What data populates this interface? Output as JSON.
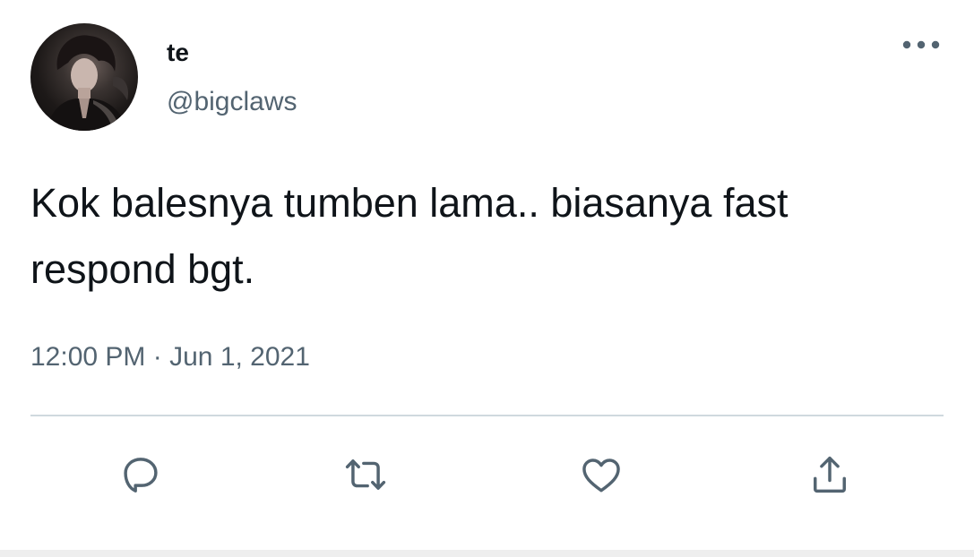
{
  "author": {
    "display_name": "te",
    "handle": "@bigclaws"
  },
  "tweet": {
    "text": "Kok balesnya tumben lama.. biasanya fast respond bgt.",
    "time": "12:00 PM",
    "separator": "·",
    "date": "Jun 1, 2021"
  },
  "icons": {
    "more": "more-dots-icon",
    "reply": "reply-bubble-icon",
    "retweet": "retweet-icon",
    "like": "heart-icon",
    "share": "share-upload-icon"
  },
  "colors": {
    "primary_text": "#0f1419",
    "secondary_text": "#536471",
    "divider": "#cfd9de"
  }
}
